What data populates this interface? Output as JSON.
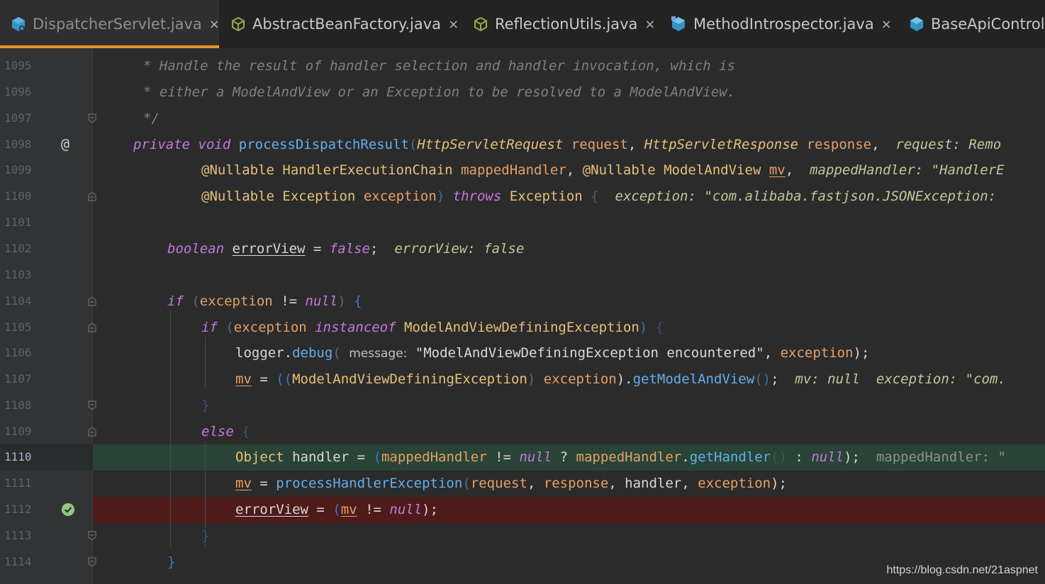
{
  "tabs": [
    {
      "label": "DispatcherServlet.java",
      "close": "×",
      "active": true
    },
    {
      "label": "AbstractBeanFactory.java",
      "close": "×",
      "active": false
    },
    {
      "label": "ReflectionUtils.java",
      "close": "×",
      "active": false
    },
    {
      "label": "MethodIntrospector.java",
      "close": "×",
      "active": false
    },
    {
      "label": "BaseApiControll",
      "close": "",
      "active": false
    }
  ],
  "line_numbers": [
    "1095",
    "1096",
    "1097",
    "1098",
    "1099",
    "1100",
    "1101",
    "1102",
    "1103",
    "1104",
    "1105",
    "1106",
    "1107",
    "1108",
    "1109",
    "1110",
    "1111",
    "1112",
    "1113",
    "1114"
  ],
  "code": {
    "l1095": "* Handle the result of handler selection and handler invocation, which is",
    "l1096": "* either a ModelAndView or an Exception to be resolved to a ModelAndView.",
    "l1097": "*/",
    "l1098": {
      "kw_private": "private",
      "kw_void": "void",
      "method": "processDispatchResult",
      "p_open": "(",
      "type1": "HttpServletRequest",
      "arg1": "request",
      "comma1": ",",
      "type2": "HttpServletResponse",
      "arg2": "response",
      "comma2": ",",
      "hint": "request: Remo"
    },
    "l1099": {
      "ann1": "@Nullable",
      "type1": "HandlerExecutionChain",
      "arg1": "mappedHandler",
      "comma1": ",",
      "ann2": "@Nullable",
      "type2": "ModelAndView",
      "arg2": "mv",
      "comma2": ",",
      "hint": "mappedHandler: \"HandlerE"
    },
    "l1100": {
      "ann": "@Nullable",
      "type": "Exception",
      "arg": "exception",
      "p_close": ")",
      "throws": "throws",
      "ex": "Exception",
      "brace": "{",
      "hint": "exception: \"com.alibaba.fastjson.JSONException:"
    },
    "l1102": {
      "type": "boolean",
      "var": "errorView",
      "eq": " = ",
      "val": "false",
      "semi": ";",
      "hint": "errorView: false"
    },
    "l1104": {
      "kw": "if",
      "p_open": "(",
      "var": "exception",
      "op": " != ",
      "val": "null",
      "p_close": ")",
      "brace": "{"
    },
    "l1105": {
      "kw": "if",
      "p_open": "(",
      "var": "exception",
      "kw2": "instanceof",
      "type": "ModelAndViewDefiningException",
      "p_close": ")",
      "brace": "{"
    },
    "l1106": {
      "obj": "logger",
      "dot": ".",
      "method": "debug",
      "p_open": "(",
      "param_hint": "message:",
      "str": "\"ModelAndViewDefiningException encountered\"",
      "comma": ",",
      "arg": "exception",
      "p_close": ");"
    },
    "l1107": {
      "var": "mv",
      "eq": " = ",
      "p1": "((",
      "type": "ModelAndViewDefiningException",
      "p2": ")",
      "arg": "exception",
      "p3": ").",
      "method": "getModelAndView",
      "p4": "()",
      "semi": ";",
      "hint1": "mv: null",
      "hint2": "exception: \"com."
    },
    "l1108": "}",
    "l1109": {
      "kw": "else",
      "brace": "{"
    },
    "l1110": {
      "type": "Object",
      "var": "handler",
      "eq": " = ",
      "p_open": "(",
      "var2": "mappedHandler",
      "op": " != ",
      "null1": "null",
      "q": " ? ",
      "var3": "mappedHandler",
      "dot": ".",
      "method": "getHandler",
      "call": "()",
      "colon": " : ",
      "null2": "null",
      "p_close": ");",
      "hint": "mappedHandler: \""
    },
    "l1111": {
      "var": "mv",
      "eq": " = ",
      "method": "processHandlerException",
      "p_open": "(",
      "a1": "request",
      "a2": "response",
      "a3": "handler",
      "a4": "exception",
      "comma": ", ",
      "p_close": ");"
    },
    "l1112": {
      "var": "errorView",
      "eq": " = ",
      "p_open": "(",
      "var2": "mv",
      "op": " != ",
      "val": "null",
      "p_close": ");"
    },
    "l1113": "}",
    "l1114": "}"
  },
  "gutter": {
    "override_marker": "@",
    "breakpoint_icon": "check-circle-icon"
  },
  "colors": {
    "accent": "#e7932b",
    "current_line": "#294436",
    "breakpoint_line": "#4e1a1a",
    "background": "#2b2b2b"
  },
  "watermark": "https://blog.csdn.net/21aspnet"
}
